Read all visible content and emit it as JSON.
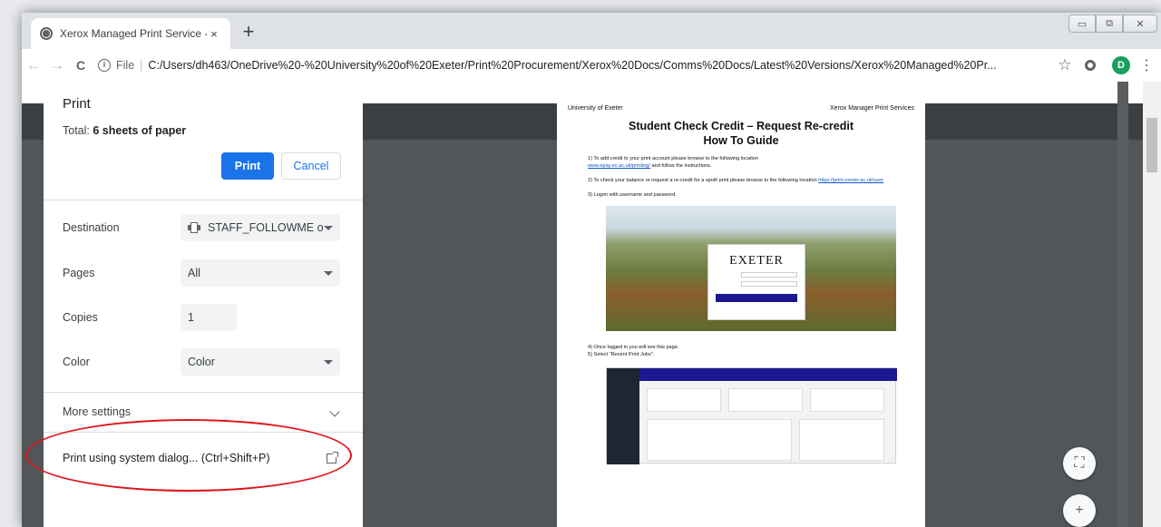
{
  "tab": {
    "title": "Xerox Managed Print Service - St",
    "close_glyph": "×",
    "new_tab_glyph": "+"
  },
  "window_controls": {
    "minimize": "▭",
    "restore": "⧉",
    "close": "✕"
  },
  "toolbar": {
    "back_glyph": "←",
    "forward_glyph": "→",
    "reload_glyph": "C",
    "scheme": "File",
    "url": "C:/Users/dh463/OneDrive%20-%20University%20of%20Exeter/Print%20Procurement/Xerox%20Docs/Comms%20Docs/Latest%20Versions/Xerox%20Managed%20Pr...",
    "star_glyph": "☆",
    "avatar_letter": "D",
    "menu_glyph": "⋮"
  },
  "print_panel": {
    "title": "Print",
    "total_prefix": "Total: ",
    "total_value": "6 sheets of paper",
    "print_button": "Print",
    "cancel_button": "Cancel",
    "destination_label": "Destination",
    "destination_value": "STAFF_FOLLOWME or",
    "pages_label": "Pages",
    "pages_value": "All",
    "copies_label": "Copies",
    "copies_value": "1",
    "color_label": "Color",
    "color_value": "Color",
    "more_settings": "More settings",
    "system_dialog": "Print using system dialog... (Ctrl+Shift+P)"
  },
  "preview": {
    "org_left": "University of Exeter",
    "org_right": "Xerox Manager Print Services",
    "heading_1": "Student Check Credit – Request Re-credit",
    "heading_2": "How To Guide",
    "step1_text": "1)   To add credit to your print account please browse to the following location",
    "step1_link": "www.epay.ex.ac.uk/printing/",
    "step1_tail": " and follow the instructions.",
    "step2_text": "2)   To check your balance or request a re-credit for a spoilt print please browse to the following location ",
    "step2_link": "https://print.exeter.ac.uk/user",
    "step3_text": "3)   Logon with username and password.",
    "login_logo": "EXETER",
    "step4_text": "4)   Once logged in you will see this page.",
    "step5_text": "5)   Select \"Recent Print Jobs\"."
  },
  "fabs": {
    "fit_glyph": "⛶",
    "zoom_in_glyph": "+"
  }
}
